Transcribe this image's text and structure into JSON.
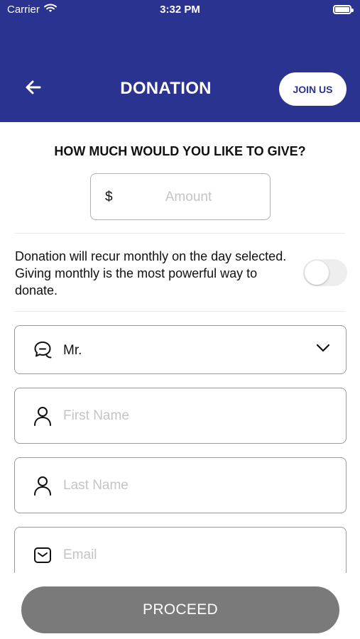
{
  "status_bar": {
    "carrier": "Carrier",
    "time": "3:32 PM"
  },
  "header": {
    "title": "DONATION",
    "join_label": "JOIN US",
    "background_color": "#2b3390"
  },
  "donation": {
    "question": "HOW MUCH WOULD YOU LIKE TO GIVE?",
    "currency_symbol": "$",
    "amount_placeholder": "Amount",
    "amount_value": ""
  },
  "recurring": {
    "text": "Donation will recur monthly on the day selected. Giving monthly is the most powerful way to donate.",
    "enabled": false
  },
  "form": {
    "title_select": {
      "selected": "Mr.",
      "icon": "chat-bubbles-icon"
    },
    "first_name": {
      "placeholder": "First Name",
      "value": "",
      "icon": "person-icon"
    },
    "last_name": {
      "placeholder": "Last Name",
      "value": "",
      "icon": "person-icon"
    },
    "email": {
      "placeholder": "Email",
      "value": "",
      "icon": "envelope-icon"
    }
  },
  "footer": {
    "proceed_label": "PROCEED"
  }
}
